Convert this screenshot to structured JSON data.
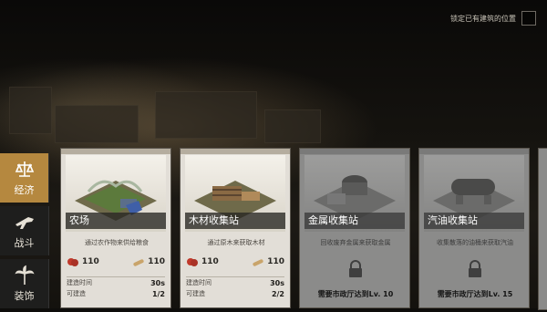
{
  "header": {
    "lock_positions_label": "锁定已有建筑的位置"
  },
  "categories": [
    {
      "label": "经济",
      "icon": "scales-icon",
      "active": true
    },
    {
      "label": "战斗",
      "icon": "rifle-icon",
      "active": false
    },
    {
      "label": "装饰",
      "icon": "palm-tree-icon",
      "active": false
    }
  ],
  "cards": [
    {
      "name": "农场",
      "desc": "通过农作物来供给粮食",
      "food": "110",
      "wood": "110",
      "build_time_label": "建造时间",
      "build_time": "30s",
      "buildable_label": "可建造",
      "buildable": "1/2"
    },
    {
      "name": "木材收集站",
      "desc": "通过原木来获取木材",
      "food": "110",
      "wood": "110",
      "build_time_label": "建造时间",
      "build_time": "30s",
      "buildable_label": "可建造",
      "buildable": "2/2"
    },
    {
      "name": "金属收集站",
      "desc": "回收废弃金属来获取金属",
      "requirement": "需要市政厅达到Lv. 10"
    },
    {
      "name": "汽油收集站",
      "desc": "收集散落的油桶来获取汽油",
      "requirement": "需要市政厅达到Lv. 15"
    }
  ],
  "colors": {
    "active_tab": "#b5883f",
    "card_bg": "#e2ded7",
    "locked_card_bg": "#8b8b8a"
  }
}
